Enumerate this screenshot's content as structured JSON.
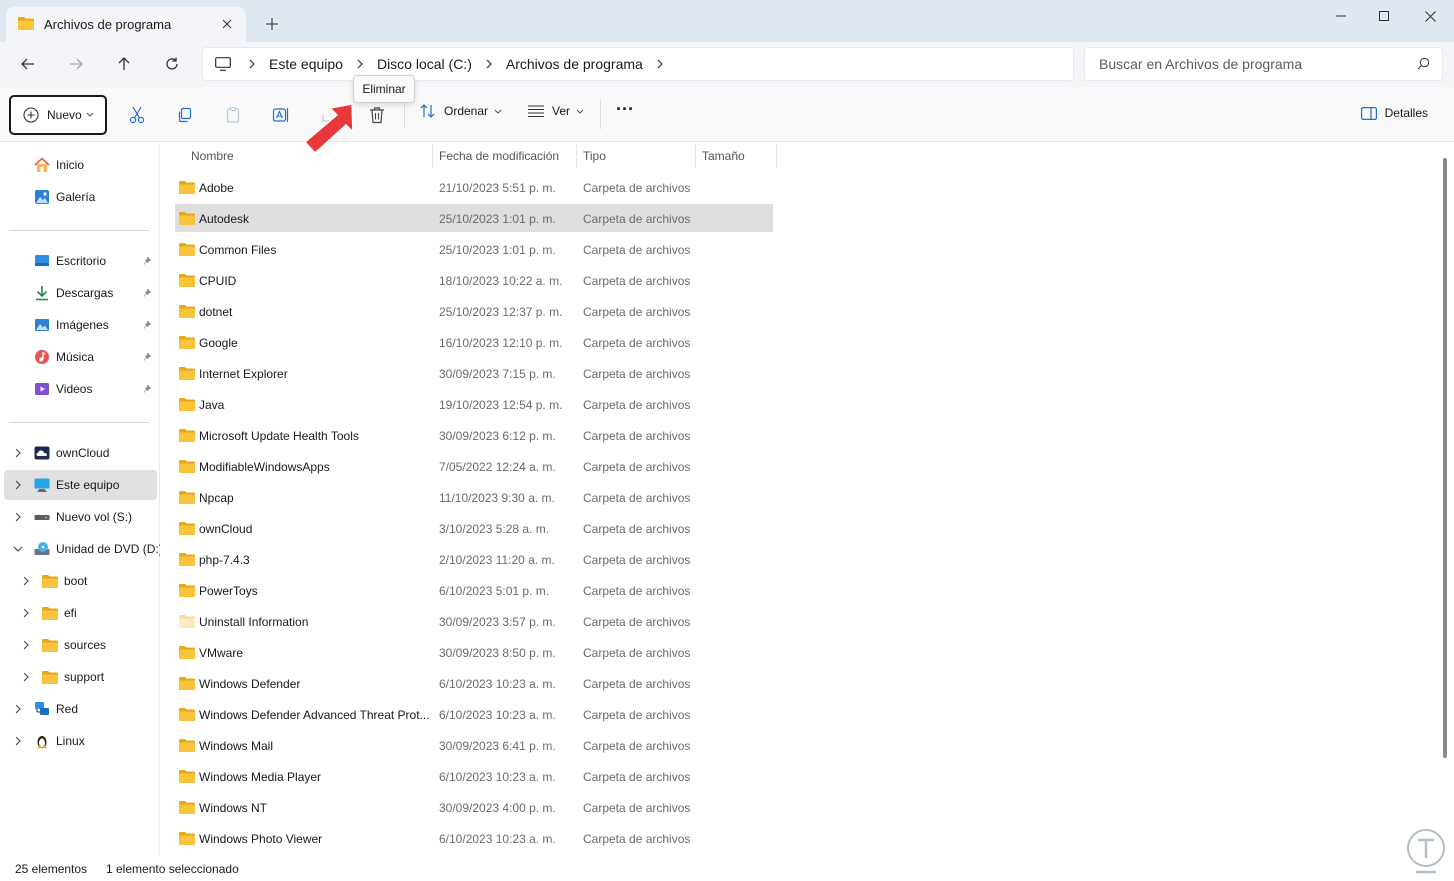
{
  "window": {
    "tab_title": "Archivos de programa"
  },
  "breadcrumb": {
    "items": [
      "Este equipo",
      "Disco local (C:)",
      "Archivos de programa"
    ]
  },
  "search": {
    "placeholder": "Buscar en Archivos de programa"
  },
  "toolbar": {
    "new_label": "Nuevo",
    "sort_label": "Ordenar",
    "view_label": "Ver",
    "more_label": "···",
    "details_label": "Detalles",
    "tooltip": "Eliminar"
  },
  "sidebar": {
    "items": [
      {
        "label": "Inicio",
        "icon": "home-icon"
      },
      {
        "label": "Galería",
        "icon": "gallery-icon"
      },
      {
        "label": "Escritorio",
        "icon": "desktop-icon",
        "pinned": true
      },
      {
        "label": "Descargas",
        "icon": "download-icon",
        "pinned": true
      },
      {
        "label": "Imágenes",
        "icon": "pictures-icon",
        "pinned": true
      },
      {
        "label": "Música",
        "icon": "music-icon",
        "pinned": true
      },
      {
        "label": "Videos",
        "icon": "videos-icon",
        "pinned": true
      },
      {
        "label": "ownCloud",
        "icon": "cloud-icon",
        "expander": "collapsed"
      },
      {
        "label": "Este equipo",
        "icon": "computer-icon",
        "expander": "collapsed",
        "selected": true
      },
      {
        "label": "Nuevo vol (S:)",
        "icon": "drive-icon",
        "expander": "collapsed"
      },
      {
        "label": "Unidad de DVD (D:)",
        "icon": "dvd-icon",
        "expander": "expanded"
      },
      {
        "label": "boot",
        "icon": "folder-icon",
        "expander": "collapsed"
      },
      {
        "label": "efi",
        "icon": "folder-icon",
        "expander": "collapsed"
      },
      {
        "label": "sources",
        "icon": "folder-icon",
        "expander": "collapsed"
      },
      {
        "label": "support",
        "icon": "folder-icon",
        "expander": "collapsed"
      },
      {
        "label": "Red",
        "icon": "network-icon",
        "expander": "collapsed"
      },
      {
        "label": "Linux",
        "icon": "linux-icon",
        "expander": "collapsed"
      }
    ]
  },
  "columns": {
    "name": "Nombre",
    "modified": "Fecha de modificación",
    "type": "Tipo",
    "size": "Tamaño"
  },
  "files": [
    {
      "name": "Adobe",
      "modified": "21/10/2023 5:51 p. m.",
      "type": "Carpeta de archivos"
    },
    {
      "name": "Autodesk",
      "modified": "25/10/2023 1:01 p. m.",
      "type": "Carpeta de archivos",
      "selected": true
    },
    {
      "name": "Common Files",
      "modified": "25/10/2023 1:01 p. m.",
      "type": "Carpeta de archivos"
    },
    {
      "name": "CPUID",
      "modified": "18/10/2023 10:22 a. m.",
      "type": "Carpeta de archivos"
    },
    {
      "name": "dotnet",
      "modified": "25/10/2023 12:37 p. m.",
      "type": "Carpeta de archivos"
    },
    {
      "name": "Google",
      "modified": "16/10/2023 12:10 p. m.",
      "type": "Carpeta de archivos"
    },
    {
      "name": "Internet Explorer",
      "modified": "30/09/2023 7:15 p. m.",
      "type": "Carpeta de archivos"
    },
    {
      "name": "Java",
      "modified": "19/10/2023 12:54 p. m.",
      "type": "Carpeta de archivos"
    },
    {
      "name": "Microsoft Update Health Tools",
      "modified": "30/09/2023 6:12 p. m.",
      "type": "Carpeta de archivos"
    },
    {
      "name": "ModifiableWindowsApps",
      "modified": "7/05/2022 12:24 a. m.",
      "type": "Carpeta de archivos"
    },
    {
      "name": "Npcap",
      "modified": "11/10/2023 9:30 a. m.",
      "type": "Carpeta de archivos"
    },
    {
      "name": "ownCloud",
      "modified": "3/10/2023 5:28 a. m.",
      "type": "Carpeta de archivos"
    },
    {
      "name": "php-7.4.3",
      "modified": "2/10/2023 11:20 a. m.",
      "type": "Carpeta de archivos"
    },
    {
      "name": "PowerToys",
      "modified": "6/10/2023 5:01 p. m.",
      "type": "Carpeta de archivos"
    },
    {
      "name": "Uninstall Information",
      "modified": "30/09/2023 3:57 p. m.",
      "type": "Carpeta de archivos",
      "hidden": true
    },
    {
      "name": "VMware",
      "modified": "30/09/2023 8:50 p. m.",
      "type": "Carpeta de archivos"
    },
    {
      "name": "Windows Defender",
      "modified": "6/10/2023 10:23 a. m.",
      "type": "Carpeta de archivos"
    },
    {
      "name": "Windows Defender Advanced Threat Prot...",
      "modified": "6/10/2023 10:23 a. m.",
      "type": "Carpeta de archivos"
    },
    {
      "name": "Windows Mail",
      "modified": "30/09/2023 6:41 p. m.",
      "type": "Carpeta de archivos"
    },
    {
      "name": "Windows Media Player",
      "modified": "6/10/2023 10:23 a. m.",
      "type": "Carpeta de archivos"
    },
    {
      "name": "Windows NT",
      "modified": "30/09/2023 4:00 p. m.",
      "type": "Carpeta de archivos"
    },
    {
      "name": "Windows Photo Viewer",
      "modified": "6/10/2023 10:23 a. m.",
      "type": "Carpeta de archivos"
    }
  ],
  "status": {
    "count": "25 elementos",
    "selection": "1 elemento seleccionado"
  },
  "colors": {
    "folder": "#F8C43C",
    "folder_dark": "#E6A817",
    "arrow": "#E8383B",
    "selection": "#DEDEDE"
  }
}
